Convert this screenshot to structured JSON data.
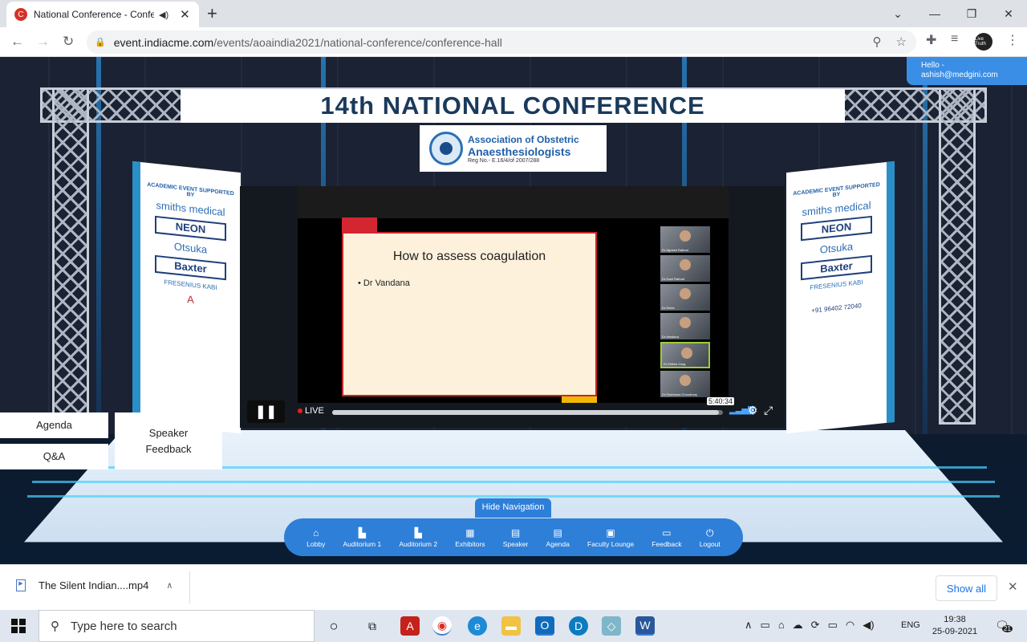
{
  "browser": {
    "tab_title": "National Conference - Confe",
    "favicon": "C",
    "url_host": "event.indiacme.com",
    "url_path": "/events/aoaindia2021/national-conference/conference-hall",
    "profile": "Live Truth"
  },
  "user": {
    "hello": "Hello -",
    "email": "ashish@medgini.com"
  },
  "stage": {
    "banner_title": "14th NATIONAL CONFERENCE",
    "org_line1": "Association of Obstetric",
    "org_line2": "Anaesthesiologists",
    "org_reg": "Reg No.- E.16/4/of 2007/288",
    "side_support": "ACADEMIC EVENT SUPPORTED BY",
    "side_sponsors": [
      "smiths medical",
      "NEON",
      "Otsuka",
      "Baxter",
      "FRESENIUS KABI",
      "A"
    ],
    "side_phone": "+91 96402 72040"
  },
  "video": {
    "slide_title": "How to assess coagulation",
    "slide_bullet": "Dr Vandana",
    "live_label": "LIVE",
    "time": "5:40:34",
    "progress": 0.99,
    "participants": [
      "Dr.Jignesh Rathod",
      "Dr.Sunil Rathod",
      "Dr.Shree",
      "Dr.Vandana",
      "Dr.Shikha Garg",
      "Dr.Shobhana Choudhary"
    ]
  },
  "side_buttons": {
    "agenda": "Agenda",
    "qa": "Q&A",
    "speaker_feedback": "Speaker Feedback"
  },
  "nav": {
    "hide_label": "Hide Navigation",
    "items": [
      {
        "label": "Lobby",
        "icon": "home-icon"
      },
      {
        "label": "Auditorium 1",
        "icon": "door-icon"
      },
      {
        "label": "Auditorium 2",
        "icon": "door-icon"
      },
      {
        "label": "Exhibitors",
        "icon": "grid-icon"
      },
      {
        "label": "Speaker",
        "icon": "doc-icon"
      },
      {
        "label": "Agenda",
        "icon": "doc-icon"
      },
      {
        "label": "Faculty Lounge",
        "icon": "screen-icon"
      },
      {
        "label": "Feedback",
        "icon": "message-icon"
      },
      {
        "label": "Logout",
        "icon": "power-icon"
      }
    ]
  },
  "downloads": {
    "file": "The Silent Indian....mp4",
    "show_all": "Show all"
  },
  "taskbar": {
    "search_placeholder": "Type here to search",
    "lang": "ENG",
    "time": "19:38",
    "date": "25-09-2021",
    "notifications": "21"
  }
}
